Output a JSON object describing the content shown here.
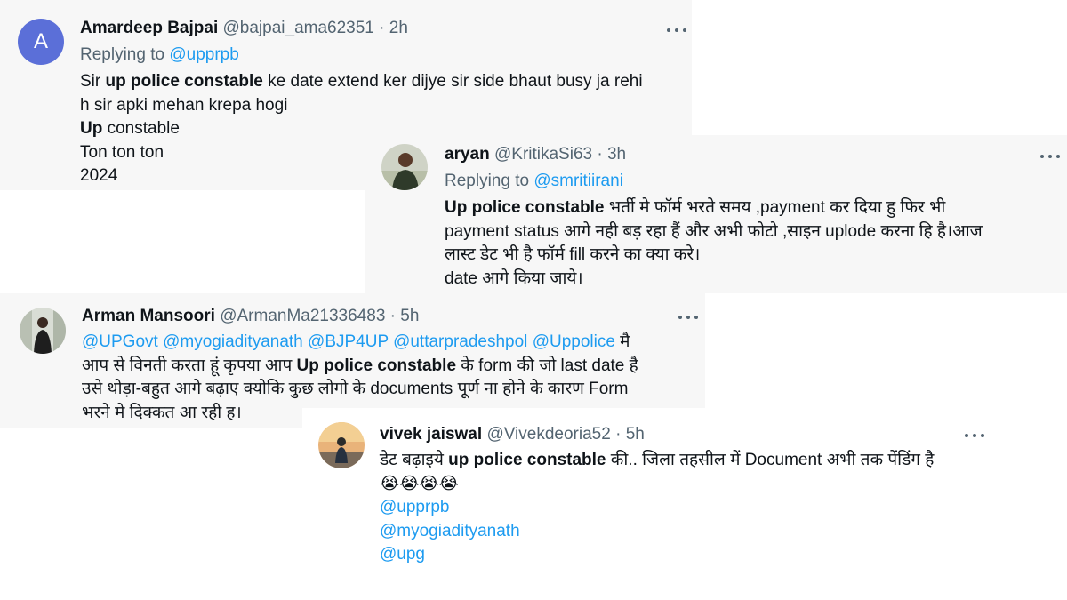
{
  "tweets": [
    {
      "name": "Amardeep Bajpai",
      "handle": "@bajpai_ama62351",
      "sep": "·",
      "time": "2h",
      "avatar_letter": "A",
      "replying_label": "Replying to",
      "replying_to": "@upprpb",
      "body": {
        "l1_pre": "Sir ",
        "l1_bold": "up police constable",
        "l1_post": " ke date extend ker dijye sir side bhaut busy ja rehi",
        "l2": "h sir apki mehan krepa hogi",
        "l3_bold": "Up",
        "l3_post": " constable",
        "l4": "Ton ton ton",
        "l5": "2024"
      }
    },
    {
      "name": "aryan",
      "handle": "@KritikaSi63",
      "sep": "·",
      "time": "3h",
      "replying_label": "Replying to",
      "replying_to": "@smritiirani",
      "body": {
        "l1_bold": "Up police constable",
        "l1_post": " भर्ती मे फॉर्म भरते समय ,payment कर दिया हु फिर भी",
        "l2": "payment status आगे नही बड़ रहा हैं और अभी फोटो ,साइन uplode करना हि है।आज",
        "l3": "लास्ट डेट भी है फॉर्म fill करने का क्या करे।",
        "l4": "date आगे किया जाये।"
      }
    },
    {
      "name": "Arman Mansoori",
      "handle": "@ArmanMa21336483",
      "sep": "·",
      "time": "5h",
      "body": {
        "m1": "@UPGovt",
        "m2": "@myogiadityanath",
        "m3": "@BJP4UP",
        "m4": "@uttarpradeshpol",
        "m5": "@Uppolice",
        "l1_post": " मै",
        "l2_pre": "आप से विनती करता हूं कृपया आप ",
        "l2_bold": "Up police constable",
        "l2_post": " के form की जो last date है",
        "l3": "उसे थोड़ा-बहुत आगे बढ़ाए क्योकि कुछ लोगो के documents पूर्ण ना होने के कारण Form",
        "l4": "भरने मे दिक्कत आ रही ह।"
      }
    },
    {
      "name": "vivek jaiswal",
      "handle": "@Vivekdeoria52",
      "sep": "·",
      "time": "5h",
      "body": {
        "l1_pre": "डेट बढ़ाइये ",
        "l1_bold": "up police constable",
        "l1_post": " की..  जिला तहसील में Document अभी तक पेंडिंग है",
        "emojis": "😭😭😭😭",
        "m1": "@upprpb",
        "m2": "@myogiadityanath",
        "m3": "@upg"
      }
    }
  ]
}
